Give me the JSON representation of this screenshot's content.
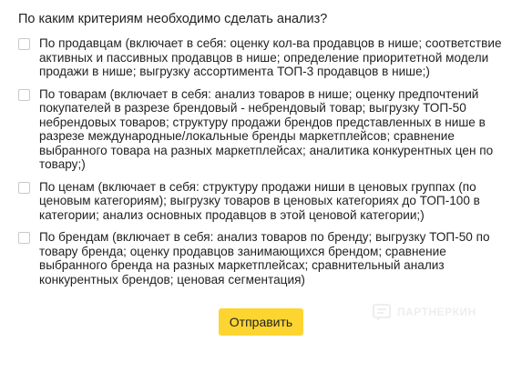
{
  "question": "По каким критериям необходимо сделать анализ?",
  "options": [
    {
      "label": "По продавцам (включает в себя: оценку кол-ва продавцов в нише; соответствие активных и пассивных продавцов в нише; определение приоритетной модели продажи в нише; выгрузку ассортимента ТОП-3 продавцов в нише;)",
      "checked": false
    },
    {
      "label": "По товарам (включает в себя: анализ товаров в нише; оценку предпочтений покупателей в разрезе брендовый - небрендовый товар; выгрузку ТОП-50 небрендовых товаров; структуру продажи брендов представленных в нише в разрезе международные/локальные бренды маркетплейсов; сравнение выбранного товара на разных маркетплейсах; аналитика конкурентных цен по товару;)",
      "checked": false
    },
    {
      "label": "По ценам (включает в себя: структуру продажи ниши в ценовых группах (по ценовым категориям); выгрузку товаров в ценовых категориях до ТОП-100 в категории; анализ основных продавцов в этой ценовой категории;)",
      "checked": false
    },
    {
      "label": "По брендам (включает в себя: анализ товаров по бренду; выгрузку ТОП-50 по товару бренда; оценку продавцов занимающихся брендом; сравнение выбранного бренда на разных маркетплейсах; сравнительный анализ конкурентных брендов; ценовая сегментация)",
      "checked": false
    }
  ],
  "submit_label": "Отправить",
  "watermark": {
    "icon": "partner-logo-icon",
    "text": "ПАРТНЕРКИН"
  },
  "colors": {
    "submit_background": "#fdd531",
    "checkbox_border": "#c9c9c9",
    "text": "#222222"
  }
}
